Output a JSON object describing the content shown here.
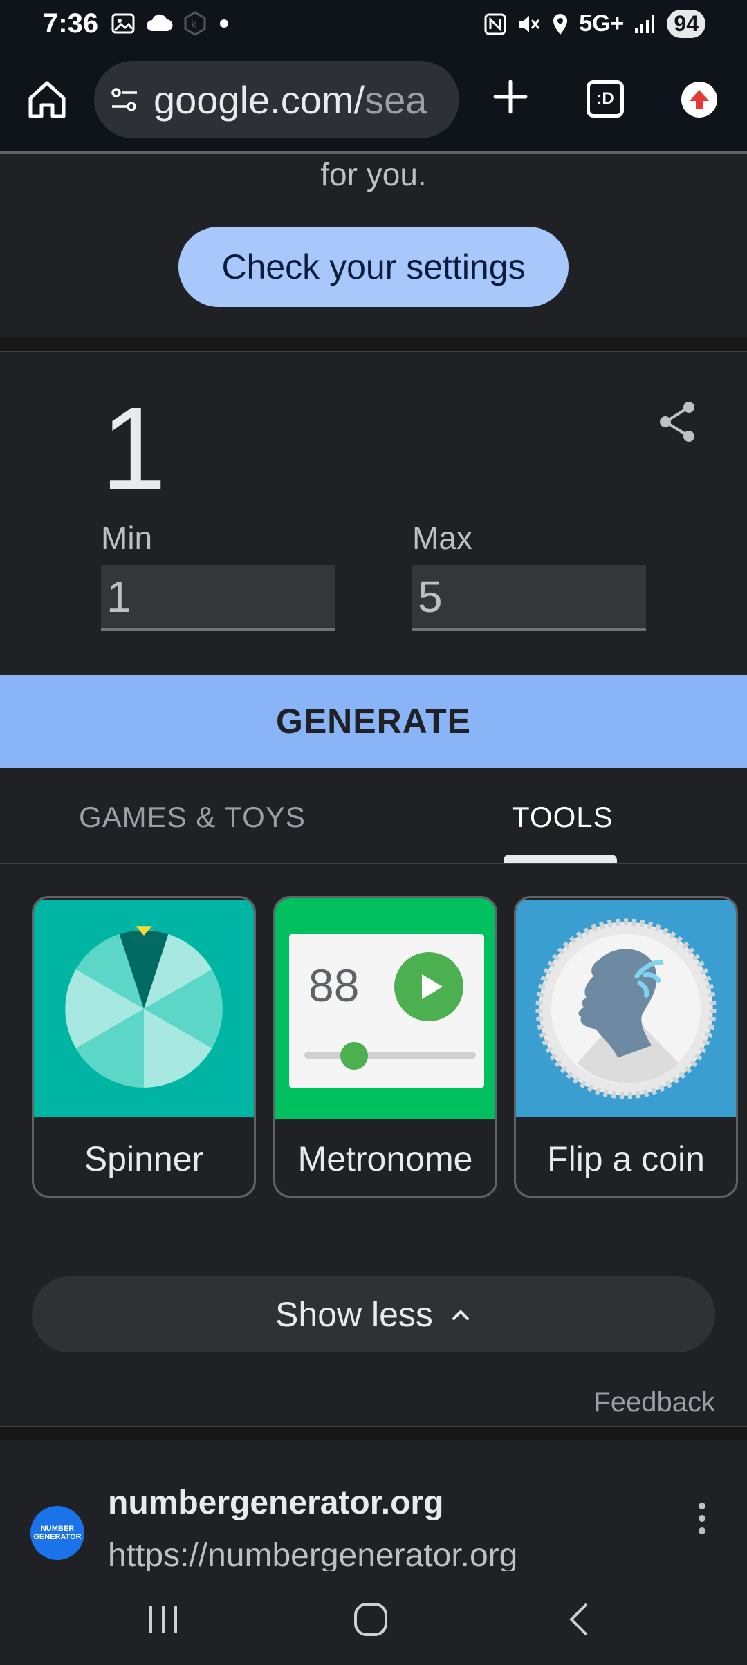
{
  "status_bar": {
    "time": "7:36",
    "network": "5G+",
    "battery": "94"
  },
  "browser": {
    "url_main": "google.com/",
    "url_rest": "sea",
    "tabs_icon_label": ":D"
  },
  "settings_card": {
    "text": "for you.",
    "button": "Check your settings"
  },
  "rng": {
    "result": "1",
    "min_label": "Min",
    "min_value": "1",
    "max_label": "Max",
    "max_value": "5",
    "generate": "GENERATE"
  },
  "tabs": [
    {
      "label": "GAMES & TOYS",
      "active": false
    },
    {
      "label": "TOOLS",
      "active": true
    }
  ],
  "tools": [
    {
      "label": "Spinner"
    },
    {
      "label": "Metronome",
      "bpm": "88"
    },
    {
      "label": "Flip a coin"
    }
  ],
  "show_less": "Show less",
  "feedback": "Feedback",
  "result": {
    "site_name": "numbergenerator.org",
    "url": "https://numbergenerator.org",
    "favicon_text": "NUMBER GENERATOR"
  },
  "colors": {
    "accent": "#8ab4f8",
    "button": "#a8c7fa",
    "spinner_bg": "#00b5a3",
    "metronome_bg": "#00c060",
    "coin_bg": "#3a9fd0"
  }
}
